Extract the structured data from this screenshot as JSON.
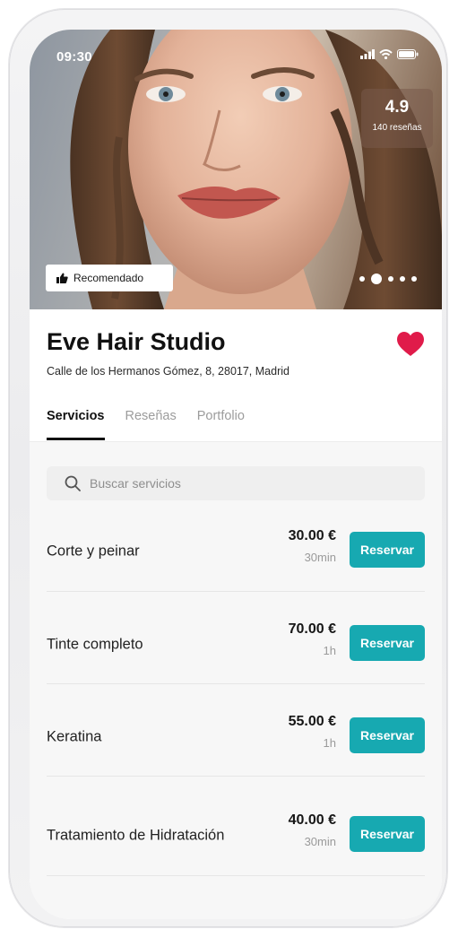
{
  "status_bar": {
    "time": "09:30"
  },
  "hero": {
    "rating": "4.9",
    "reviews": "140 reseñas",
    "badge_label": "Recomendado",
    "gallery_photo_count": 5,
    "gallery_active_index": 1
  },
  "salon": {
    "name": "Eve Hair Studio",
    "address": "Calle de los Hermanos Gómez, 8, 28017, Madrid",
    "favorited": true
  },
  "tabs": [
    {
      "label": "Servicios",
      "active": true
    },
    {
      "label": "Reseñas",
      "active": false
    },
    {
      "label": "Portfolio",
      "active": false
    }
  ],
  "search": {
    "placeholder": "Buscar servicios",
    "value": ""
  },
  "services": [
    {
      "name": "Corte y peinar",
      "price": "30.00 €",
      "duration": "30min",
      "button": "Reservar"
    },
    {
      "name": "Tinte completo",
      "price": "70.00 €",
      "duration": "1h",
      "button": "Reservar"
    },
    {
      "name": "Keratina",
      "price": "55.00 €",
      "duration": "1h",
      "button": "Reservar"
    },
    {
      "name": "Tratamiento de Hidratación",
      "price": "40.00 €",
      "duration": "30min",
      "button": "Reservar"
    }
  ],
  "colors": {
    "accent": "#17a9b1",
    "heart": "#e01b4a",
    "title": "#111111"
  },
  "icons": {
    "signal": "signal-icon",
    "wifi": "wifi-icon",
    "battery": "battery-icon",
    "thumbs_up": "thumbs-up-icon",
    "favorite": "heart-icon",
    "search": "search-icon"
  }
}
